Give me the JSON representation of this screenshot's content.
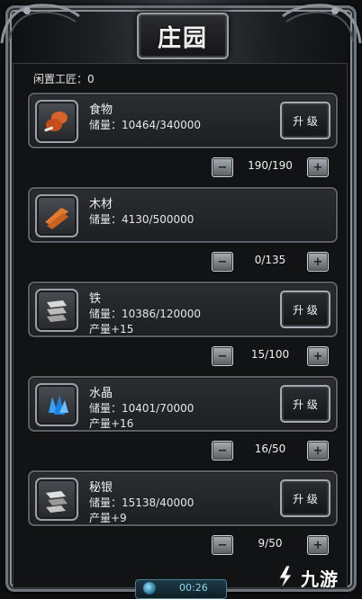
{
  "title": "庄园",
  "idle_workers": "闲置工匠：0",
  "resources": [
    {
      "name": "食物",
      "storage": "储量：10464/340000",
      "production": "",
      "icon": "food-icon",
      "upgrade_label": "升 级",
      "has_upgrade": true,
      "count": "190/190"
    },
    {
      "name": "木材",
      "storage": "储量：4130/500000",
      "production": "",
      "icon": "wood-icon",
      "upgrade_label": "",
      "has_upgrade": false,
      "count": "0/135"
    },
    {
      "name": "铁",
      "storage": "储量：10386/120000",
      "production": "产量+15",
      "icon": "iron-icon",
      "upgrade_label": "升 级",
      "has_upgrade": true,
      "count": "15/100"
    },
    {
      "name": "水晶",
      "storage": "储量：10401/70000",
      "production": "产量+16",
      "icon": "crystal-icon",
      "upgrade_label": "升 级",
      "has_upgrade": true,
      "count": "16/50"
    },
    {
      "name": "秘银",
      "storage": "储量：15138/40000",
      "production": "产量+9",
      "icon": "mithril-icon",
      "upgrade_label": "升 级",
      "has_upgrade": true,
      "count": "9/50"
    }
  ],
  "bottom_timer": "00:26",
  "watermark": "九游",
  "colors": {
    "accent_blue": "#8fd5ef",
    "food": "#d9642a",
    "wood": "#e07a2e",
    "crystal": "#3aa0ff",
    "metal": "#cfcfcf"
  }
}
